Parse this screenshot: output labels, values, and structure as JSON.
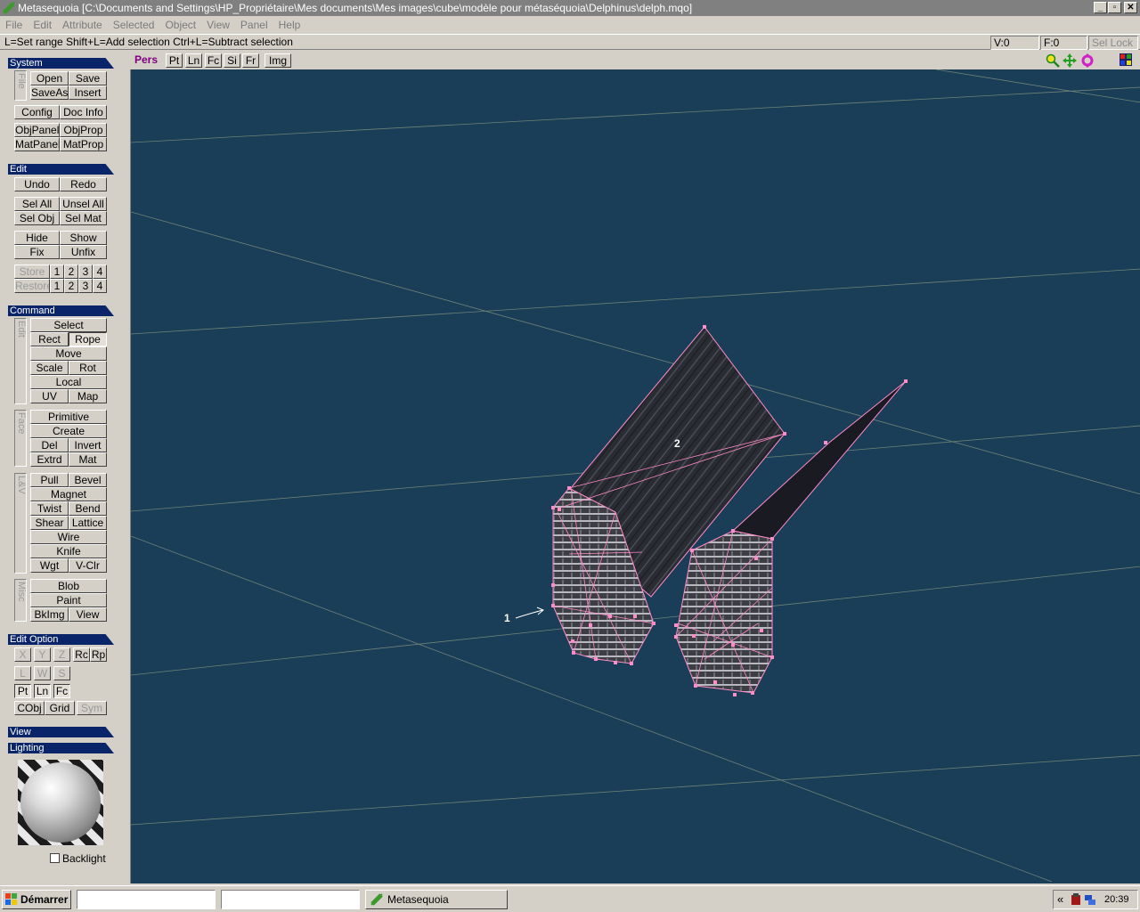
{
  "window": {
    "title": "Metasequoia [C:\\Documents and Settings\\HP_Propriétaire\\Mes documents\\Mes images\\cube\\modèle pour métaséquoia\\Delphinus\\delph.mqo]",
    "minimize_glyph": "_",
    "restore_glyph": "▫",
    "close_glyph": "✕"
  },
  "menu": [
    "File",
    "Edit",
    "Attribute",
    "Selected",
    "Object",
    "View",
    "Panel",
    "Help"
  ],
  "status": {
    "hint": "L=Set range  Shift+L=Add selection  Ctrl+L=Subtract selection",
    "vertex_count": "V:0",
    "face_count": "F:0",
    "sel_lock": "Sel Lock"
  },
  "panel": {
    "system": {
      "title": "System",
      "group": "File",
      "open": "Open",
      "save": "Save",
      "saveas": "SaveAs",
      "insert": "Insert",
      "config": "Config",
      "docinfo": "Doc Info",
      "objpanel": "ObjPanel",
      "objprop": "ObjProp",
      "matpanel": "MatPanel",
      "matprop": "MatProp"
    },
    "edit": {
      "title": "Edit",
      "undo": "Undo",
      "redo": "Redo",
      "selall": "Sel All",
      "unselall": "Unsel All",
      "selobj": "Sel Obj",
      "selmat": "Sel Mat",
      "hide": "Hide",
      "show": "Show",
      "fix": "Fix",
      "unfix": "Unfix",
      "store": "Store",
      "restore": "Restore",
      "n1": "1",
      "n2": "2",
      "n3": "3",
      "n4": "4"
    },
    "command": {
      "title": "Command",
      "g_edit": "Edit",
      "g_face": "Face",
      "g_lv": "L&V",
      "g_misc": "Misc",
      "select": "Select",
      "rect": "Rect",
      "rope": "Rope",
      "move": "Move",
      "scale": "Scale",
      "rot": "Rot",
      "local": "Local",
      "uv": "UV",
      "map": "Map",
      "primitive": "Primitive",
      "create": "Create",
      "del": "Del",
      "invert": "Invert",
      "extrd": "Extrd",
      "mat": "Mat",
      "pull": "Pull",
      "bevel": "Bevel",
      "magnet": "Magnet",
      "twist": "Twist",
      "bend": "Bend",
      "shear": "Shear",
      "lattice": "Lattice",
      "wire": "Wire",
      "knife": "Knife",
      "wgt": "Wgt",
      "vclr": "V-Clr",
      "blob": "Blob",
      "paint": "Paint",
      "bkimg": "BkImg",
      "view": "View"
    },
    "editoption": {
      "title": "Edit Option",
      "x": "X",
      "y": "Y",
      "z": "Z",
      "rc": "Rc",
      "rp": "Rp",
      "l": "L",
      "w": "W",
      "s": "S",
      "pt": "Pt",
      "ln": "Ln",
      "fc": "Fc",
      "cobj": "CObj",
      "grid": "Grid",
      "sym": "Sym"
    },
    "view": {
      "title": "View"
    },
    "lighting": {
      "title": "Lighting",
      "backlight": "Backlight"
    }
  },
  "viewbar": {
    "pers": "Pers",
    "pt": "Pt",
    "ln": "Ln",
    "fc": "Fc",
    "si": "Si",
    "fr": "Fr",
    "img": "Img"
  },
  "viewport": {
    "label1": "1",
    "label2": "2"
  },
  "taskbar": {
    "start": "Démarrer",
    "task": "Metasequoia",
    "clock": "20:39",
    "chevron": "«"
  },
  "colors": {
    "viewport_bg": "#1a3d58",
    "wire": "#ff8cc8",
    "section_header": "#0a246a",
    "accent_text": "#800080"
  }
}
